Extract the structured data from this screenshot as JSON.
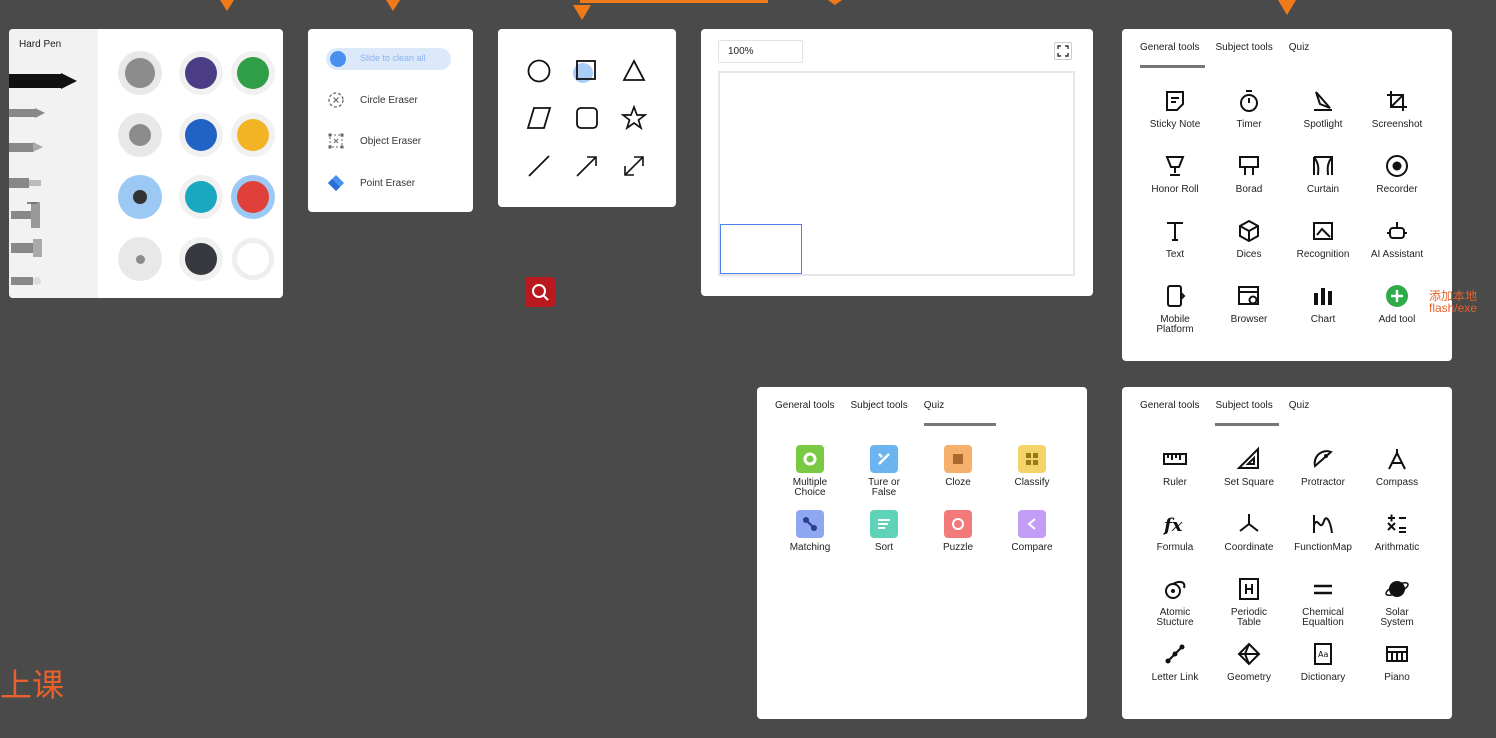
{
  "pen_panel": {
    "title": "Hard Pen",
    "colors": [
      "#8c8c8c",
      "#4a3d86",
      "#2f9e47",
      "#8c8c8c",
      "#2063c4",
      "#f2b424",
      "#333333",
      "#1aa7c0",
      "#e0403a",
      "#8c8c8c",
      "#36393d",
      "#ffffff"
    ]
  },
  "eraser_panel": {
    "slide_label": "Slide to clean all",
    "items": [
      {
        "label": "Circle Eraser",
        "icon": "circle-eraser-icon"
      },
      {
        "label": "Object Eraser",
        "icon": "object-eraser-icon"
      },
      {
        "label": "Point Eraser",
        "icon": "point-eraser-icon"
      }
    ]
  },
  "shape_panel": {
    "shapes": [
      "circle",
      "square",
      "triangle",
      "parallelogram",
      "rounded-square",
      "star",
      "line",
      "arrow",
      "double-arrow"
    ]
  },
  "preview_panel": {
    "zoom": "100%"
  },
  "general_tools_panel": {
    "tabs": [
      "General tools",
      "Subject tools",
      "Quiz"
    ],
    "active_tab": "General tools",
    "tools": [
      "Sticky Note",
      "Timer",
      "Spotlight",
      "Screenshot",
      "Honor Roll",
      "Borad",
      "Curtain",
      "Recorder",
      "Text",
      "Dices",
      "Recognition",
      "AI Assistant",
      "Mobile Platform",
      "Browser",
      "Chart",
      "Add tool"
    ],
    "side_note": "添加本地\nflash/exe"
  },
  "quiz_panel": {
    "tabs": [
      "General tools",
      "Subject tools",
      "Quiz"
    ],
    "active_tab": "Quiz",
    "items": [
      {
        "label": "Multiple Choice",
        "color": "#7ac943"
      },
      {
        "label": "Ture or False",
        "color": "#6cb4f0"
      },
      {
        "label": "Cloze",
        "color": "#f5b06b"
      },
      {
        "label": "Classify",
        "color": "#f3d36a"
      },
      {
        "label": "Matching",
        "color": "#8fa7f0"
      },
      {
        "label": "Sort",
        "color": "#5fd3b8"
      },
      {
        "label": "Puzzle",
        "color": "#f27a7a"
      },
      {
        "label": "Compare",
        "color": "#c39cf5"
      }
    ]
  },
  "subject_tools_panel": {
    "tabs": [
      "General tools",
      "Subject tools",
      "Quiz"
    ],
    "active_tab": "Subject tools",
    "tools": [
      "Ruler",
      "Set Square",
      "Protractor",
      "Compass",
      "Formula",
      "Coordinate",
      "FunctionMap",
      "Arithmatic",
      "Atomic Stucture",
      "Periodic Table",
      "Chemical Equaltion",
      "Solar System",
      "Letter Link",
      "Geometry",
      "Dictionary",
      "Piano"
    ]
  },
  "bottom_label": "上课",
  "accent_color": "#f07a1a"
}
